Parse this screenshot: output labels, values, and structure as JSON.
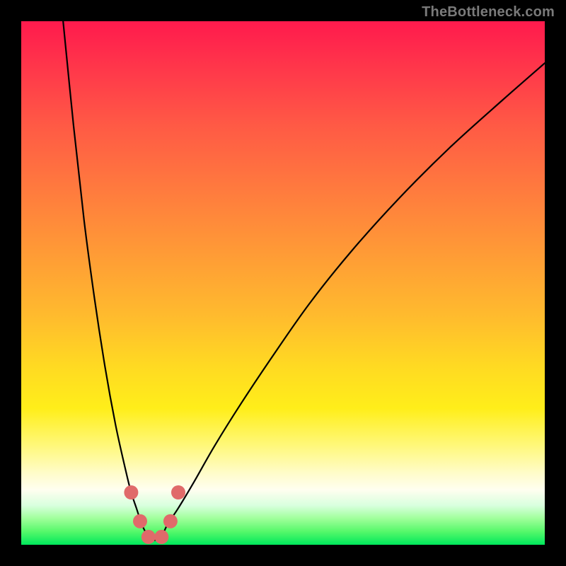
{
  "watermark": "TheBottleneck.com",
  "chart_data": {
    "type": "line",
    "title": "",
    "xlabel": "",
    "ylabel": "",
    "xlim": [
      0,
      100
    ],
    "ylim": [
      0,
      100
    ],
    "grid": false,
    "legend": false,
    "series": [
      {
        "name": "bottleneck-curve",
        "x": [
          8,
          10,
          12,
          14,
          16,
          18,
          20,
          21,
          22,
          23,
          24,
          25,
          26,
          27,
          28,
          30,
          33,
          37,
          42,
          48,
          55,
          63,
          72,
          82,
          92,
          100
        ],
        "y": [
          100,
          80,
          62,
          47,
          34,
          23,
          14,
          10,
          7,
          4,
          2,
          1,
          1,
          2,
          4,
          7,
          12,
          19,
          27,
          36,
          46,
          56,
          66,
          76,
          85,
          92
        ]
      }
    ],
    "markers": [
      {
        "x": 21.0,
        "y": 10.0
      },
      {
        "x": 22.7,
        "y": 4.5
      },
      {
        "x": 24.3,
        "y": 1.5
      },
      {
        "x": 26.8,
        "y": 1.5
      },
      {
        "x": 28.5,
        "y": 4.5
      },
      {
        "x": 30.0,
        "y": 10.0
      }
    ],
    "marker_style": {
      "color": "#e06a6a",
      "radius_px": 10
    },
    "background_gradient": {
      "direction": "top-to-bottom",
      "stops": [
        {
          "pos": 0.0,
          "color": "#ff1a4d"
        },
        {
          "pos": 0.32,
          "color": "#ff7a3e"
        },
        {
          "pos": 0.66,
          "color": "#ffda22"
        },
        {
          "pos": 0.87,
          "color": "#fffccc"
        },
        {
          "pos": 1.0,
          "color": "#00e85c"
        }
      ]
    }
  }
}
